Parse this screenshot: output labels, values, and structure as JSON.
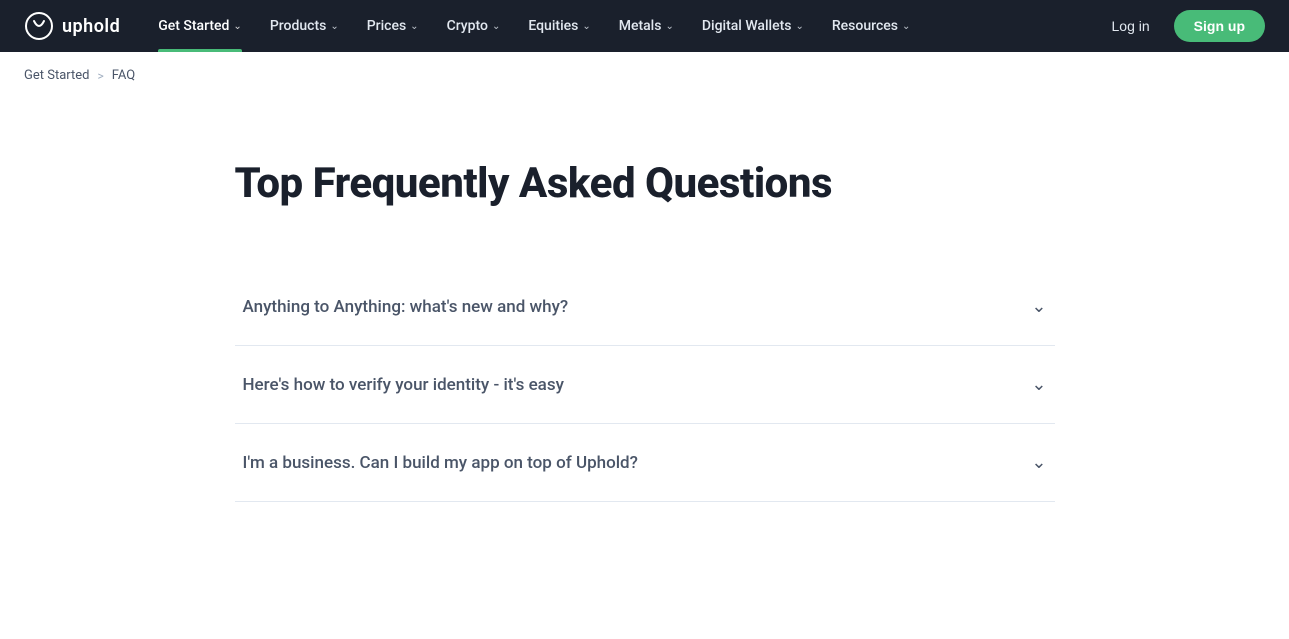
{
  "nav": {
    "logo_text": "uphold",
    "items": [
      {
        "id": "get-started",
        "label": "Get Started",
        "active": true
      },
      {
        "id": "products",
        "label": "Products",
        "active": false
      },
      {
        "id": "prices",
        "label": "Prices",
        "active": false
      },
      {
        "id": "crypto",
        "label": "Crypto",
        "active": false
      },
      {
        "id": "equities",
        "label": "Equities",
        "active": false
      },
      {
        "id": "metals",
        "label": "Metals",
        "active": false
      },
      {
        "id": "digital-wallets",
        "label": "Digital Wallets",
        "active": false
      },
      {
        "id": "resources",
        "label": "Resources",
        "active": false
      }
    ],
    "login_label": "Log in",
    "signup_label": "Sign up"
  },
  "breadcrumb": {
    "parent_label": "Get Started",
    "separator": ">",
    "current_label": "FAQ"
  },
  "main": {
    "title": "Top Frequently Asked Questions",
    "faq_items": [
      {
        "id": "faq-1",
        "question": "Anything to Anything: what's new and why?"
      },
      {
        "id": "faq-2",
        "question": "Here's how to verify your identity - it's easy"
      },
      {
        "id": "faq-3",
        "question": "I'm a business. Can I build my app on top of Uphold?"
      }
    ]
  }
}
